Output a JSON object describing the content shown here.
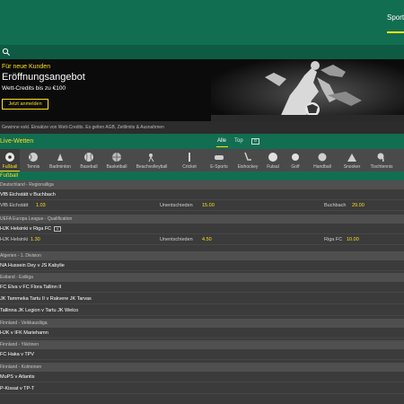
{
  "header": {
    "nav_sport": "Sport"
  },
  "banner": {
    "subtitle": "Für neue Kunden",
    "title": "Eröffnungsangebot",
    "description": "Wett-Credits bis zu €100",
    "cta": "Jetzt anmelden",
    "terms": "Gewinne exkl. Einsätze von Wett-Credits. Es gelten AGB, Zeitlimits & Ausnahmen"
  },
  "live": {
    "title": "Live-Wetten",
    "tabs": [
      "Alle",
      "Top"
    ],
    "badge": "8",
    "accent": "#ffdf1b",
    "brand": "#126e51"
  },
  "sports": [
    {
      "label": "Fußball",
      "icon": "football-icon",
      "active": true
    },
    {
      "label": "Tennis",
      "icon": "tennis-icon"
    },
    {
      "label": "Badminton",
      "icon": "badminton-icon"
    },
    {
      "label": "Baseball",
      "icon": "baseball-icon"
    },
    {
      "label": "Basketball",
      "icon": "basketball-icon"
    },
    {
      "label": "Beachvolleyball",
      "icon": "beachvolleyball-icon"
    },
    {
      "label": "Cricket",
      "icon": "cricket-icon"
    },
    {
      "label": "E-Sports",
      "icon": "esports-icon"
    },
    {
      "label": "Eishockey",
      "icon": "icehockey-icon"
    },
    {
      "label": "Futsal",
      "icon": "futsal-icon"
    },
    {
      "label": "Golf",
      "icon": "golf-icon"
    },
    {
      "label": "Handball",
      "icon": "handball-icon"
    },
    {
      "label": "Snooker",
      "icon": "snooker-icon"
    },
    {
      "label": "Tischtennis",
      "icon": "tabletennis-icon"
    }
  ],
  "section": {
    "title": "Fußball"
  },
  "list": {
    "leagues": [
      "Deutschland - Regionalliga",
      "UEFA Europa League - Qualification",
      "Algerien - 1. Division",
      "Estland - Esiliiga",
      "Finnland - Veikkausliiga",
      "Finnland - Ykkönen",
      "Finnland - Kolmonen"
    ],
    "matches": [
      "VfB Eichstätt v Buchbach",
      "HJK Helsinki v Riga FC",
      "NA Hussein Dey v JS Kabylie",
      "FC Elva v FC Flora Tallinn II",
      "JK Tammeka Tartu II v Rakvere JK Tarvas",
      "Tallinna JK Legion v Tartu JK Welco",
      "HJK v IFK Mariehamn",
      "FC Haka v TPV",
      "MuPS v Atlantis",
      "P-Kissat v TP-T"
    ],
    "odds": [
      {
        "home": "VfB Eichstätt",
        "home_odd": "1.03",
        "draw": "Unentschieden",
        "draw_odd": "15.00",
        "away": "Buchbach",
        "away_odd": "29.00"
      },
      {
        "home": "HJK Helsinki",
        "home_odd": "1.30",
        "draw": "Unentschieden",
        "draw_odd": "4.50",
        "away": "Riga FC",
        "away_odd": "10.00"
      }
    ],
    "match_badge": "8"
  }
}
